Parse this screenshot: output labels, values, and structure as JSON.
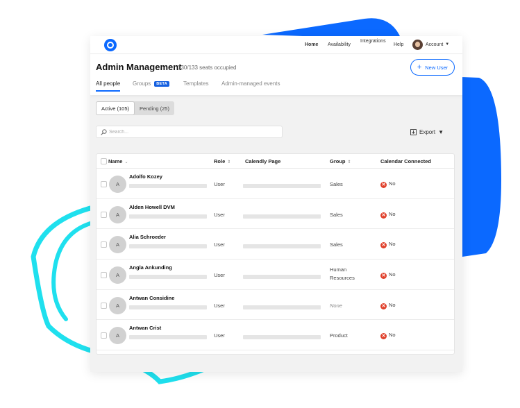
{
  "nav": {
    "links": [
      {
        "label": "Home"
      },
      {
        "label": "Availability"
      },
      {
        "label": "Integrations"
      },
      {
        "label": "Help"
      }
    ],
    "account_label": "Account"
  },
  "header": {
    "title": "Admin Management",
    "seats": "130/133 seats occupied",
    "new_user_label": "New User",
    "tabs": [
      {
        "label": "All people"
      },
      {
        "label": "Groups",
        "badge": "BETA"
      },
      {
        "label": "Templates"
      },
      {
        "label": "Admin-managed events"
      }
    ]
  },
  "filters": {
    "segments": [
      {
        "label": "Active (105)"
      },
      {
        "label": "Pending (25)"
      }
    ],
    "search_placeholder": "Search...",
    "export_label": "Export"
  },
  "table": {
    "columns": [
      {
        "label": "Name"
      },
      {
        "label": "Role"
      },
      {
        "label": "Calendly Page"
      },
      {
        "label": "Group"
      },
      {
        "label": "Calendar Connected"
      }
    ],
    "rows": [
      {
        "initial": "A",
        "name": "Adolfo Kozey",
        "role": "User",
        "group": "Sales",
        "calendar": "No"
      },
      {
        "initial": "A",
        "name": "Alden Howell DVM",
        "role": "User",
        "group": "Sales",
        "calendar": "No"
      },
      {
        "initial": "A",
        "name": "Alia Schroeder",
        "role": "User",
        "group": "Sales",
        "calendar": "No"
      },
      {
        "initial": "A",
        "name": "Angla Ankunding",
        "role": "User",
        "group": "Human Resources",
        "group_line1": "Human",
        "group_line2": "Resources",
        "calendar": "No"
      },
      {
        "initial": "A",
        "name": "Antwan Considine",
        "role": "User",
        "group": "None",
        "calendar": "No"
      },
      {
        "initial": "A",
        "name": "Antwan Crist",
        "role": "User",
        "group": "Product",
        "calendar": "No"
      }
    ]
  },
  "colors": {
    "accent": "#0b69ff",
    "blob_blue": "#0b69ff",
    "blob_cyan": "#1fe0ee",
    "no_red": "#e0412c"
  }
}
